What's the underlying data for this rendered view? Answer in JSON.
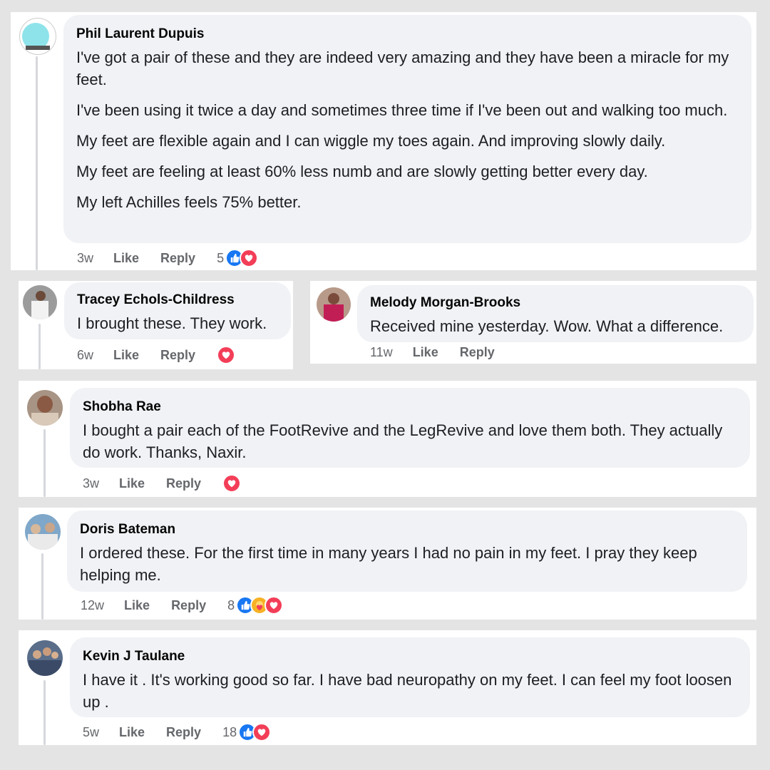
{
  "comments": [
    {
      "name": "Phil Laurent Dupuis",
      "paragraphs": [
        "I've got a pair of these and they are indeed very amazing and they have been a miracle for my feet.",
        "I've been using it twice a day and sometimes three time if I've been out and walking too much.",
        "My feet are flexible again and I can wiggle my toes again. And improving slowly daily.",
        "My feet are feeling at least 60% less numb and are slowly getting better every day.",
        "My left Achilles feels 75% better."
      ],
      "time": "3w",
      "like_label": "Like",
      "reply_label": "Reply",
      "reaction_count": "5",
      "reactions": [
        "like-icon",
        "love-icon"
      ]
    },
    {
      "name": "Tracey Echols-Childress",
      "paragraphs": [
        "I brought these. They work."
      ],
      "time": "6w",
      "like_label": "Like",
      "reply_label": "Reply",
      "reaction_count": "",
      "reactions": [
        "love-icon"
      ]
    },
    {
      "name": "Melody Morgan-Brooks",
      "paragraphs": [
        "Received mine yesterday. Wow. What a difference."
      ],
      "time": "11w",
      "like_label": "Like",
      "reply_label": "Reply",
      "reaction_count": "",
      "reactions": []
    },
    {
      "name": "Shobha Rae",
      "paragraphs": [
        "I bought a pair each of the FootRevive and the LegRevive and love them both. They actually do work. Thanks, Naxir."
      ],
      "time": "3w",
      "like_label": "Like",
      "reply_label": "Reply",
      "reaction_count": "",
      "reactions": [
        "love-icon"
      ]
    },
    {
      "name": "Doris Bateman",
      "paragraphs": [
        "I ordered these. For the first time in many years I had no pain in my feet. I pray they keep helping me."
      ],
      "time": "12w",
      "like_label": "Like",
      "reply_label": "Reply",
      "reaction_count": "8",
      "reactions": [
        "like-icon",
        "care-icon",
        "love-icon"
      ]
    },
    {
      "name": "Kevin J Taulane",
      "paragraphs": [
        "I have it . It's working good so far. I have bad neuropathy on my feet. I can feel my foot loosen up ."
      ],
      "time": "5w",
      "like_label": "Like",
      "reply_label": "Reply",
      "reaction_count": "18",
      "reactions": [
        "like-icon",
        "love-icon"
      ]
    }
  ],
  "colors": {
    "page_bg": "#e4e4e4",
    "card_bg": "#ffffff",
    "bubble_bg": "#f0f2f5",
    "like_blue": "#1877f2",
    "love_red": "#f33e58",
    "care_yellow": "#f7b125",
    "meta_gray": "#65676b"
  }
}
